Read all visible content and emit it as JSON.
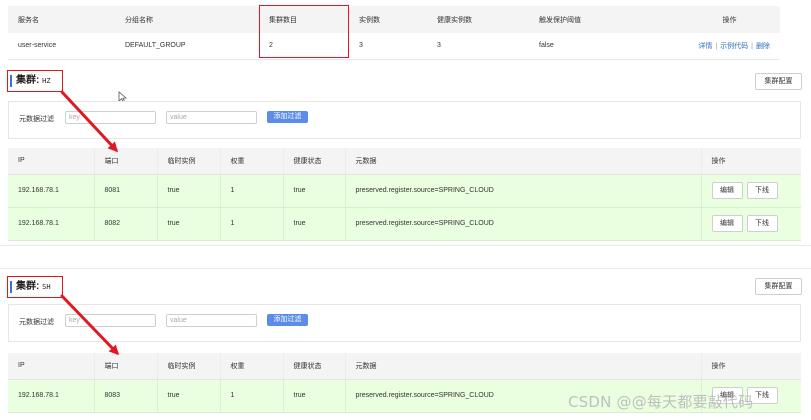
{
  "service_table": {
    "headers": [
      "服务名",
      "分组名称",
      "集群数目",
      "实例数",
      "健康实例数",
      "触发保护阈值",
      "操作"
    ],
    "row": {
      "service_name": "user-service",
      "group": "DEFAULT_GROUP",
      "cluster_count": "2",
      "instance_count": "3",
      "healthy_count": "3",
      "threshold": "false",
      "actions": [
        "详情",
        "示例代码",
        "删除"
      ],
      "separator": "|"
    }
  },
  "clusters": [
    {
      "label": "集群:",
      "name": "HZ",
      "config_button": "集群配置",
      "filter": {
        "label": "元数据过滤",
        "key_placeholder": "key",
        "value_placeholder": "value",
        "add_button": "添加过滤"
      },
      "headers": [
        "IP",
        "端口",
        "临时实例",
        "权重",
        "健康状态",
        "元数据",
        "操作"
      ],
      "rows": [
        {
          "ip": "192.168.78.1",
          "port": "8081",
          "ephemeral": "true",
          "weight": "1",
          "healthy": "true",
          "metadata": "preserved.register.source=SPRING_CLOUD",
          "edit": "编辑",
          "offline": "下线"
        },
        {
          "ip": "192.168.78.1",
          "port": "8082",
          "ephemeral": "true",
          "weight": "1",
          "healthy": "true",
          "metadata": "preserved.register.source=SPRING_CLOUD",
          "edit": "编辑",
          "offline": "下线"
        }
      ]
    },
    {
      "label": "集群:",
      "name": "SH",
      "config_button": "集群配置",
      "filter": {
        "label": "元数据过滤",
        "key_placeholder": "key",
        "value_placeholder": "value",
        "add_button": "添加过滤"
      },
      "headers": [
        "IP",
        "端口",
        "临时实例",
        "权重",
        "健康状态",
        "元数据",
        "操作"
      ],
      "rows": [
        {
          "ip": "192.168.78.1",
          "port": "8083",
          "ephemeral": "true",
          "weight": "1",
          "healthy": "true",
          "metadata": "preserved.register.source=SPRING_CLOUD",
          "edit": "编辑",
          "offline": "下线"
        }
      ]
    }
  ],
  "watermark": "CSDN @@每天都要敲代码",
  "colors": {
    "annotation_red": "#e0181f",
    "row_green": "#eaffdf",
    "link_blue": "#2a6fc4",
    "filter_button": "#5a8ce8"
  },
  "icons": [
    "mouse-cursor-icon",
    "annotation-arrow"
  ]
}
